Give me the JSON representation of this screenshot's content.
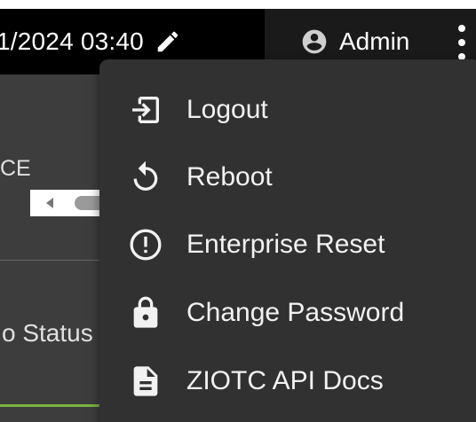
{
  "header": {
    "datetime": "1/2024 03:40",
    "user_label": "Admin"
  },
  "background": {
    "section_label": "CE",
    "status_label": "o Status"
  },
  "menu": {
    "items": [
      {
        "label": "Logout",
        "icon": "logout-icon"
      },
      {
        "label": "Reboot",
        "icon": "reboot-icon"
      },
      {
        "label": "Enterprise Reset",
        "icon": "alert-circle-icon"
      },
      {
        "label": "Change Password",
        "icon": "lock-icon"
      },
      {
        "label": "ZIOTC API Docs",
        "icon": "document-icon"
      }
    ]
  },
  "colors": {
    "topbar": "#1a1a1a",
    "menu_background": "#313131",
    "text": "#f2f2f2",
    "accent_green": "#7cb342"
  }
}
